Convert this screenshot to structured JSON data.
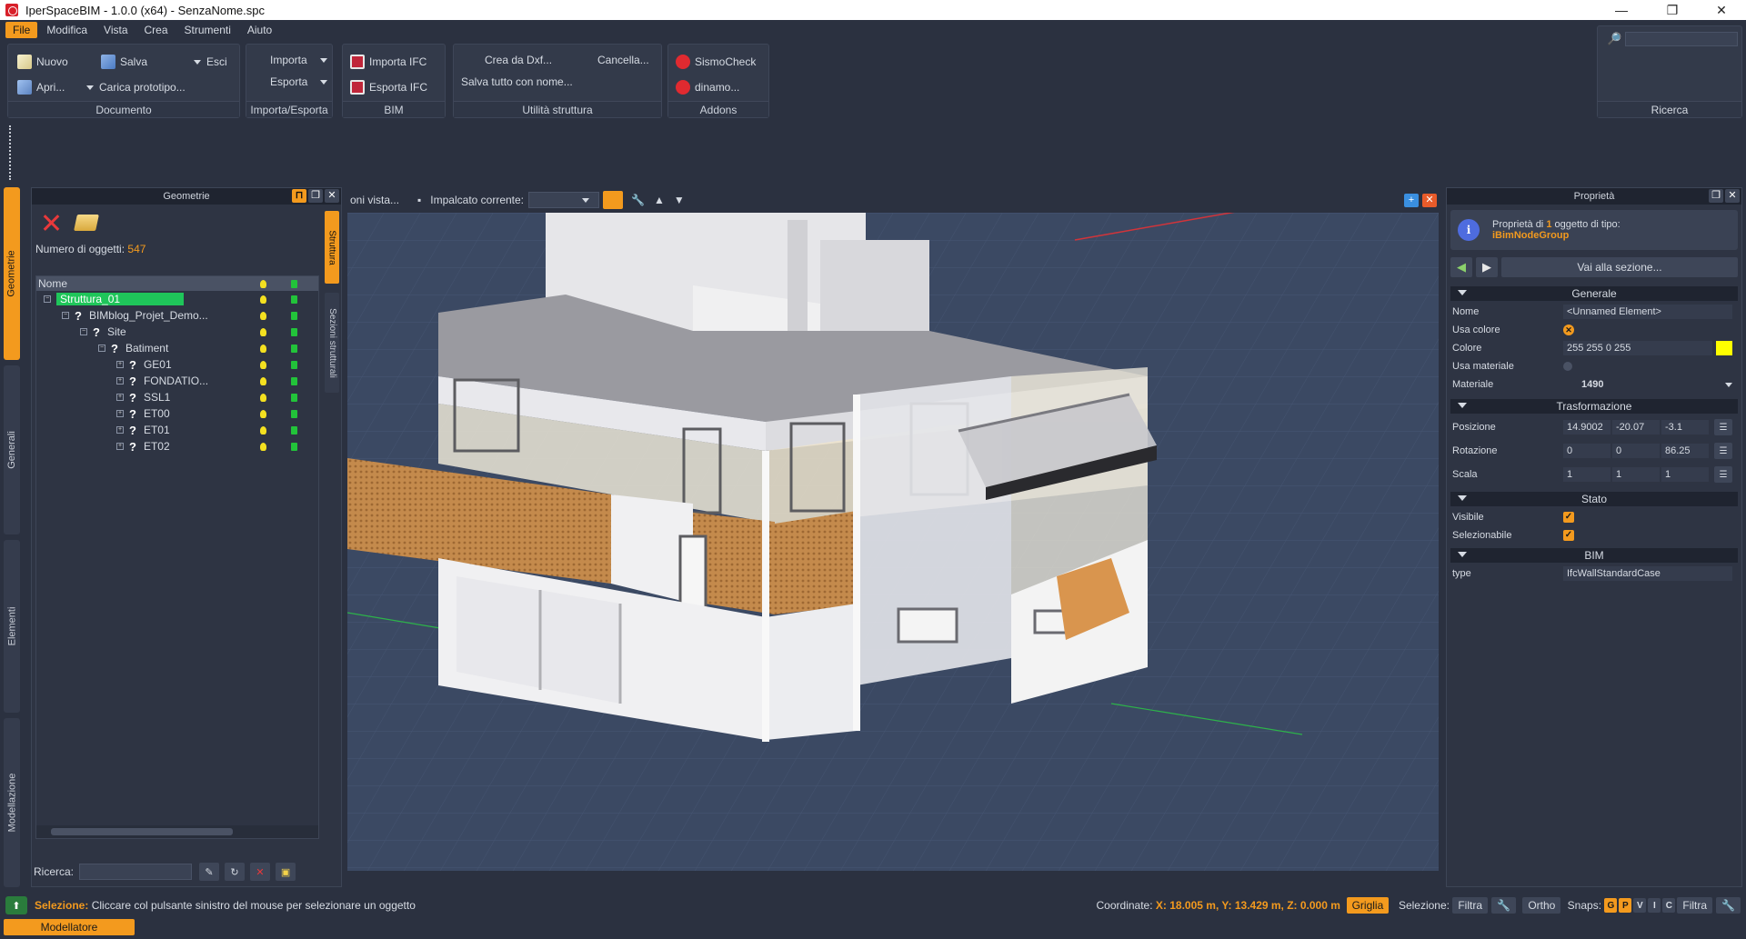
{
  "window": {
    "title": "IperSpaceBIM - 1.0.0 (x64) - SenzaNome.spc"
  },
  "menu": [
    "File",
    "Modifica",
    "Vista",
    "Crea",
    "Strumenti",
    "Aiuto"
  ],
  "ribbon": {
    "documento": {
      "title": "Documento",
      "nuovo": "Nuovo",
      "salva": "Salva",
      "esci": "Esci",
      "apri": "Apri...",
      "carica": "Carica prototipo..."
    },
    "importa": {
      "title": "Importa/Esporta",
      "importa": "Importa",
      "esporta": "Esporta"
    },
    "bim": {
      "title": "BIM",
      "importa_ifc": "Importa IFC",
      "esporta_ifc": "Esporta IFC"
    },
    "utilita": {
      "title": "Utilità struttura",
      "crea_dxf": "Crea da Dxf...",
      "cancella": "Cancella...",
      "salva_tutto": "Salva tutto con nome..."
    },
    "addons": {
      "title": "Addons",
      "sismo": "SismoCheck",
      "dinamo": "dinamo..."
    },
    "ricerca": {
      "title": "Ricerca",
      "placeholder": ""
    }
  },
  "left_tabs": [
    "Geometrie",
    "Generali",
    "Elementi",
    "Modellazione"
  ],
  "geometry": {
    "title": "Geometrie",
    "count_label": "Numero di oggetti:",
    "count": "547",
    "col_name": "Nome",
    "tree": [
      {
        "label": "Struttura_01",
        "level": 0
      },
      {
        "label": "BIMblog_Projet_Demo...",
        "level": 1
      },
      {
        "label": "Site",
        "level": 2
      },
      {
        "label": "Batiment",
        "level": 3
      },
      {
        "label": "GE01",
        "level": 4
      },
      {
        "label": "FONDATIO...",
        "level": 4
      },
      {
        "label": "SSL1",
        "level": 4
      },
      {
        "label": "ET00",
        "level": 4
      },
      {
        "label": "ET01",
        "level": 4
      },
      {
        "label": "ET02",
        "level": 4
      }
    ],
    "search_label": "Ricerca:",
    "side_tabs": [
      "Struttura",
      "Sezioni strutturali"
    ]
  },
  "viewport": {
    "views_label": "oni vista...",
    "floor_label": "Impalcato corrente:"
  },
  "properties": {
    "title": "Proprietà",
    "header_prefix": "Proprietà di",
    "header_num": "1",
    "header_suffix": "oggetto di tipo:",
    "header_type": "iBimNodeGroup",
    "goto_section": "Vai alla sezione...",
    "sections": {
      "generale": "Generale",
      "trasformazione": "Trasformazione",
      "stato": "Stato",
      "bim": "BIM"
    },
    "nome_k": "Nome",
    "nome_v": "<Unnamed Element>",
    "usa_colore_k": "Usa colore",
    "colore_k": "Colore",
    "colore_v": "255 255 0 255",
    "colore_swatch": "#ffff00",
    "usa_materiale_k": "Usa materiale",
    "materiale_k": "Materiale",
    "materiale_v": "1490",
    "posizione_k": "Posizione",
    "pos": [
      "14.9002",
      "-20.07",
      "-3.1"
    ],
    "rotazione_k": "Rotazione",
    "rot": [
      "0",
      "0",
      "86.25"
    ],
    "scala_k": "Scala",
    "scala": [
      "1",
      "1",
      "1"
    ],
    "visibile_k": "Visibile",
    "selezionabile_k": "Selezionabile",
    "type_k": "type",
    "type_v": "IfcWallStandardCase"
  },
  "status": {
    "selection_label": "Selezione:",
    "selection_text": "Cliccare col pulsante sinistro del mouse per selezionare un oggetto",
    "coord_label": "Coordinate:",
    "coord_value": "X: 18.005 m, Y: 13.429 m, Z: 0.000 m",
    "griglia": "Griglia",
    "sel_label": "Selezione:",
    "filtra": "Filtra",
    "ortho": "Ortho",
    "snaps": "Snaps:",
    "snap_chips": [
      "G",
      "P",
      "V",
      "I",
      "C"
    ],
    "filtra2": "Filtra",
    "mode": "Modellatore"
  },
  "colors": {
    "accent": "#f39a1e",
    "selected": "#1fc55a",
    "bg": "#2b3140"
  }
}
